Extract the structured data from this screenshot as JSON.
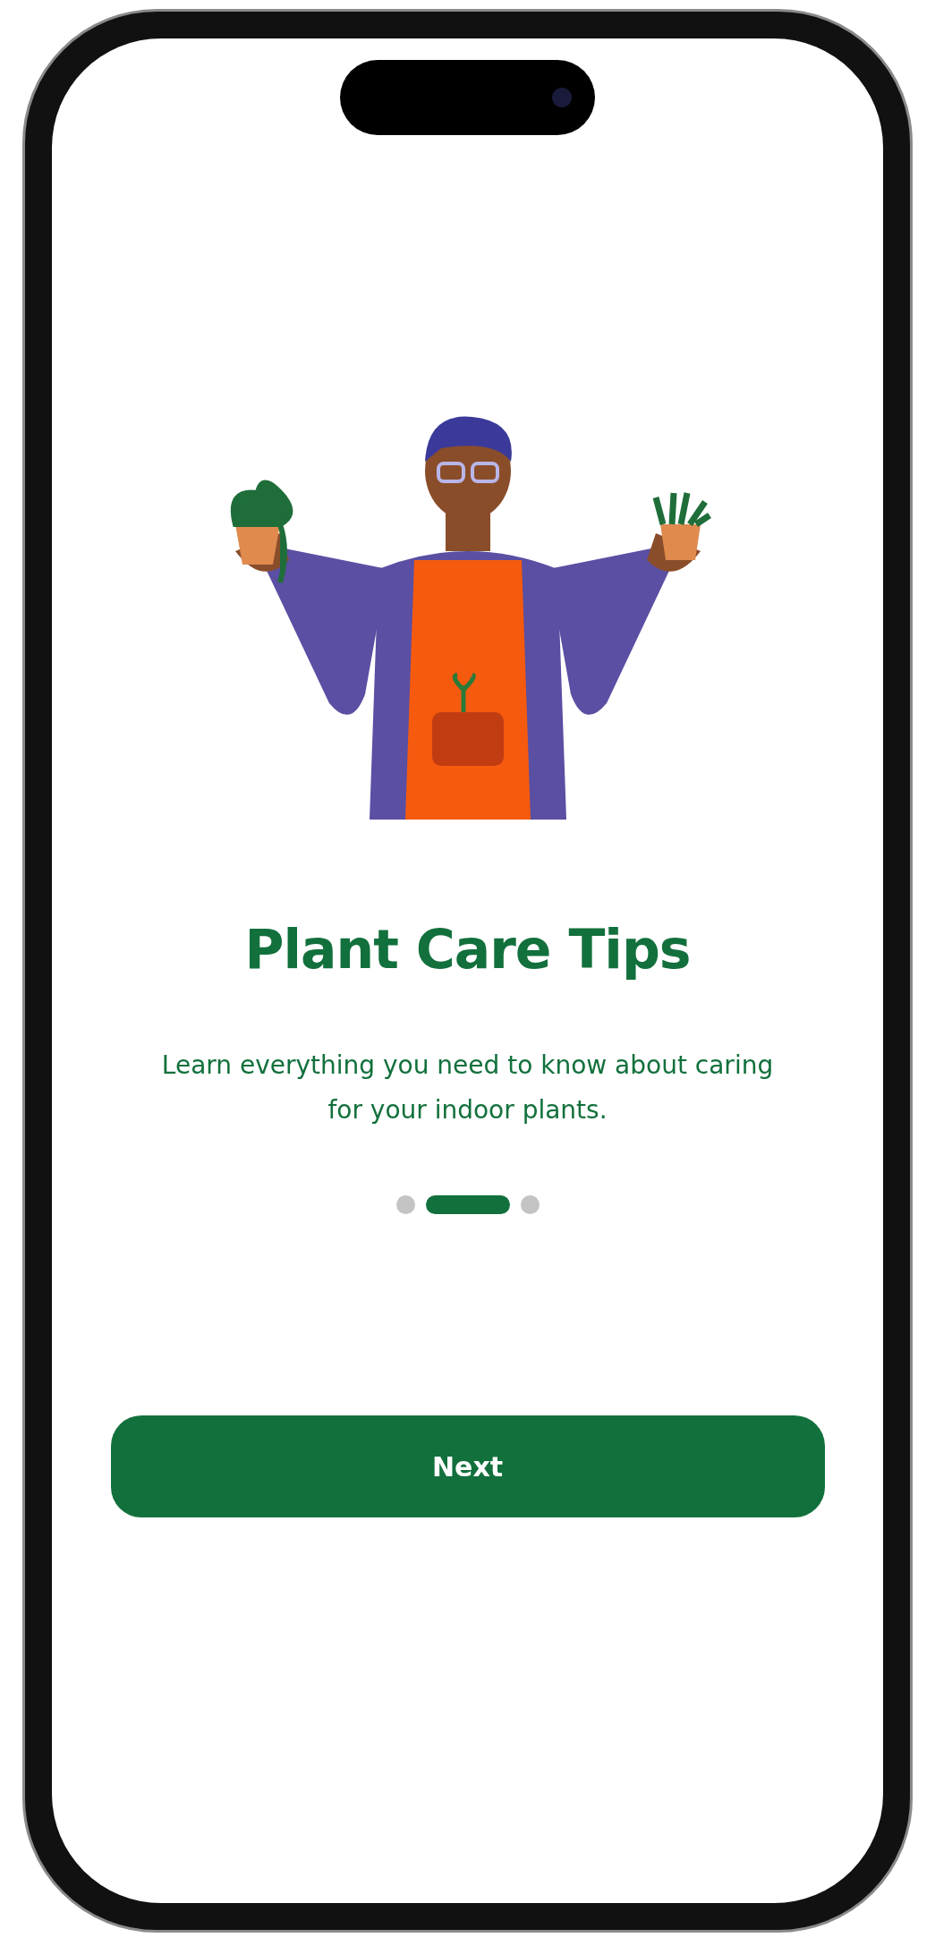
{
  "onboarding": {
    "title": "Plant Care Tips",
    "description": "Learn everything you need to know about caring for your indoor plants.",
    "pages": [
      {
        "selected": false
      },
      {
        "selected": true
      },
      {
        "selected": false
      }
    ],
    "button": "Next"
  }
}
